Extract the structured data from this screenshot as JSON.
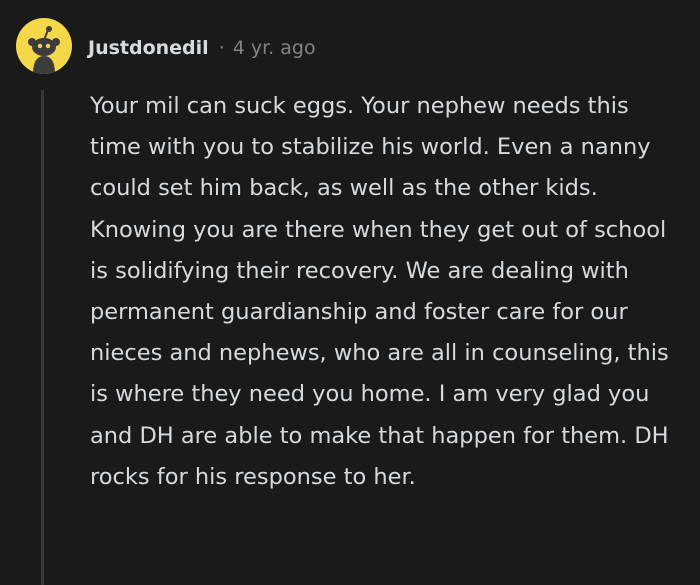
{
  "comment": {
    "author": "Justdonedil",
    "separator": "·",
    "age": "4 yr. ago",
    "body": "Your mil can suck eggs. Your nephew needs this time with you to stabilize his world. Even a nanny could set him back, as well as the other kids. Knowing you are there when they get out of school is solidifying their recovery. We are dealing with permanent guardianship and foster care for our nieces and nephews, who are all in counseling, this is where they need you home. I am very glad you and DH are able to make that happen for them. DH rocks for his response to her.",
    "avatar_icon": "reddit-snoo-avatar-icon"
  },
  "colors": {
    "background": "#1a1a1b",
    "text": "#d7dadc",
    "meta": "#818384",
    "avatar_bg": "#f5d84a",
    "thread_line": "#3a3a3c"
  }
}
